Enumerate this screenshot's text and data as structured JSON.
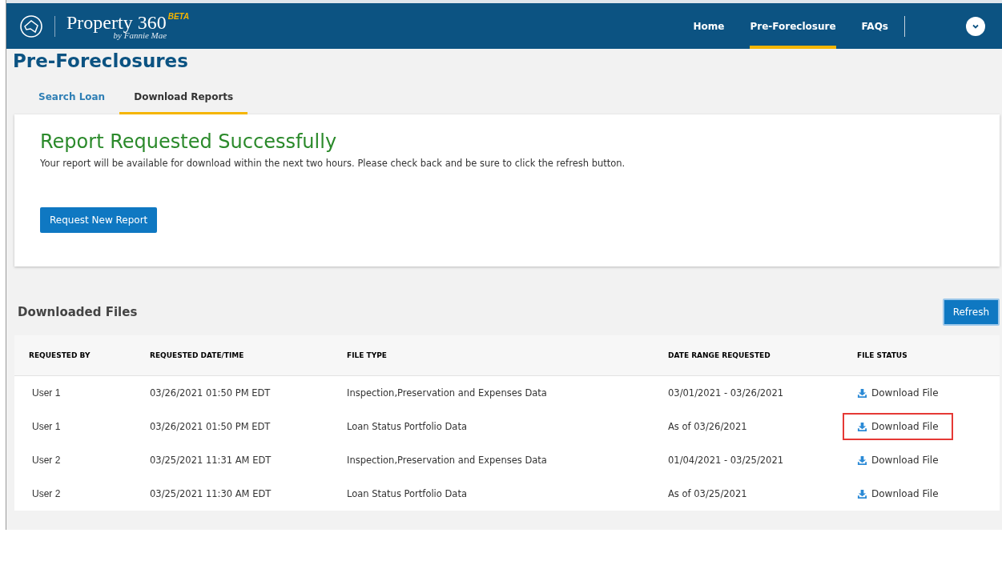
{
  "header": {
    "brand": "Property 360",
    "badge": "BETA",
    "byline": "by Fannie Mae",
    "nav": [
      {
        "label": "Home",
        "selected": false
      },
      {
        "label": "Pre-Foreclosure",
        "selected": true
      },
      {
        "label": "FAQs",
        "selected": false
      }
    ]
  },
  "page_title": "Pre-Foreclosures",
  "tabs": [
    {
      "label": "Search Loan",
      "selected": false
    },
    {
      "label": "Download Reports",
      "selected": true
    }
  ],
  "notice": {
    "title": "Report Requested Successfully",
    "message": "Your report will be available for download within the next two hours. Please check back and be sure to click the refresh button.",
    "button": "Request New Report"
  },
  "files": {
    "title": "Downloaded Files",
    "refresh": "Refresh",
    "columns": [
      "REQUESTED BY",
      "REQUESTED DATE/TIME",
      "FILE TYPE",
      "DATE RANGE REQUESTED",
      "FILE STATUS"
    ],
    "rows": [
      {
        "user": "User 1",
        "datetime": "03/26/2021 01:50 PM EDT",
        "file_type": "Inspection,Preservation and Expenses Data",
        "range": "03/01/2021 - 03/26/2021",
        "status": "Download File",
        "highlighted": false
      },
      {
        "user": "User 1",
        "datetime": "03/26/2021 01:50 PM EDT",
        "file_type": "Loan Status Portfolio Data",
        "range": "As of 03/26/2021",
        "status": "Download File",
        "highlighted": true
      },
      {
        "user": "User 2",
        "datetime": "03/25/2021 11:31 AM EDT",
        "file_type": "Inspection,Preservation and Expenses Data",
        "range": "01/04/2021 - 03/25/2021",
        "status": "Download File",
        "highlighted": false
      },
      {
        "user": "User 2",
        "datetime": "03/25/2021 11:30 AM EDT",
        "file_type": "Loan Status Portfolio Data",
        "range": "As of 03/25/2021",
        "status": "Download File",
        "highlighted": false
      }
    ]
  }
}
